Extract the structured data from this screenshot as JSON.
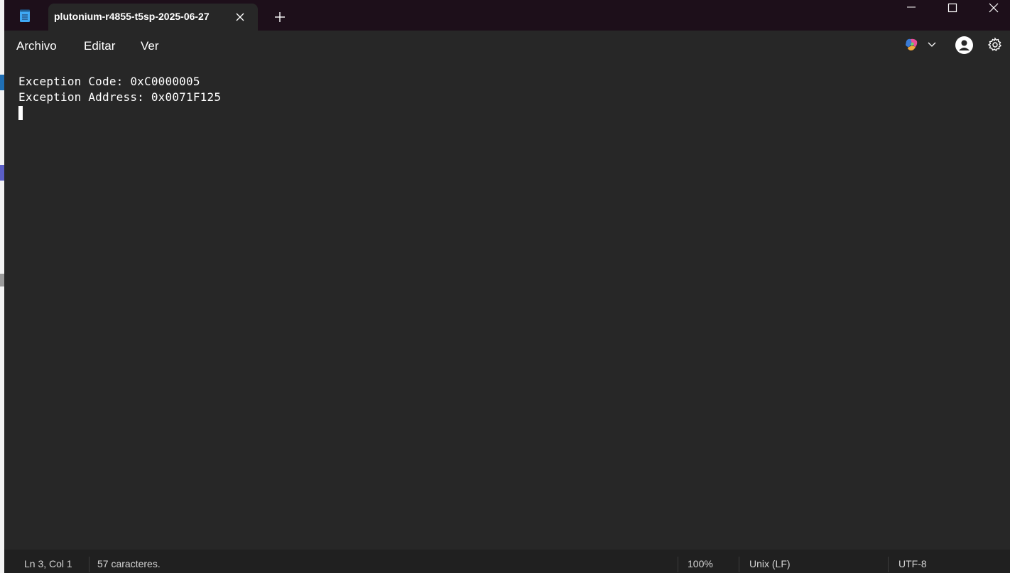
{
  "tab": {
    "title": "plutonium-r4855-t5sp-2025-06-27"
  },
  "menu": {
    "items": [
      "Archivo",
      "Editar",
      "Ver"
    ]
  },
  "editor": {
    "lines": [
      "Exception Code: 0xC0000005",
      "Exception Address: 0x0071F125"
    ]
  },
  "status": {
    "position": "Ln 3, Col 1",
    "characters": "57 caracteres.",
    "zoom": "100%",
    "line_ending": "Unix (LF)",
    "encoding": "UTF-8"
  },
  "colors": {
    "titlebar": "#1d0f1a",
    "editor_bg": "#272727",
    "statusbar": "#202020",
    "app_icon": "#3fa9f5"
  },
  "icons": {
    "app": "notepad-icon",
    "tab_close": "close-icon",
    "new_tab": "plus-icon",
    "minimize": "minimize-icon",
    "maximize": "maximize-icon",
    "close": "close-icon",
    "copilot": "copilot-icon",
    "account": "account-icon",
    "settings": "gear-icon"
  }
}
